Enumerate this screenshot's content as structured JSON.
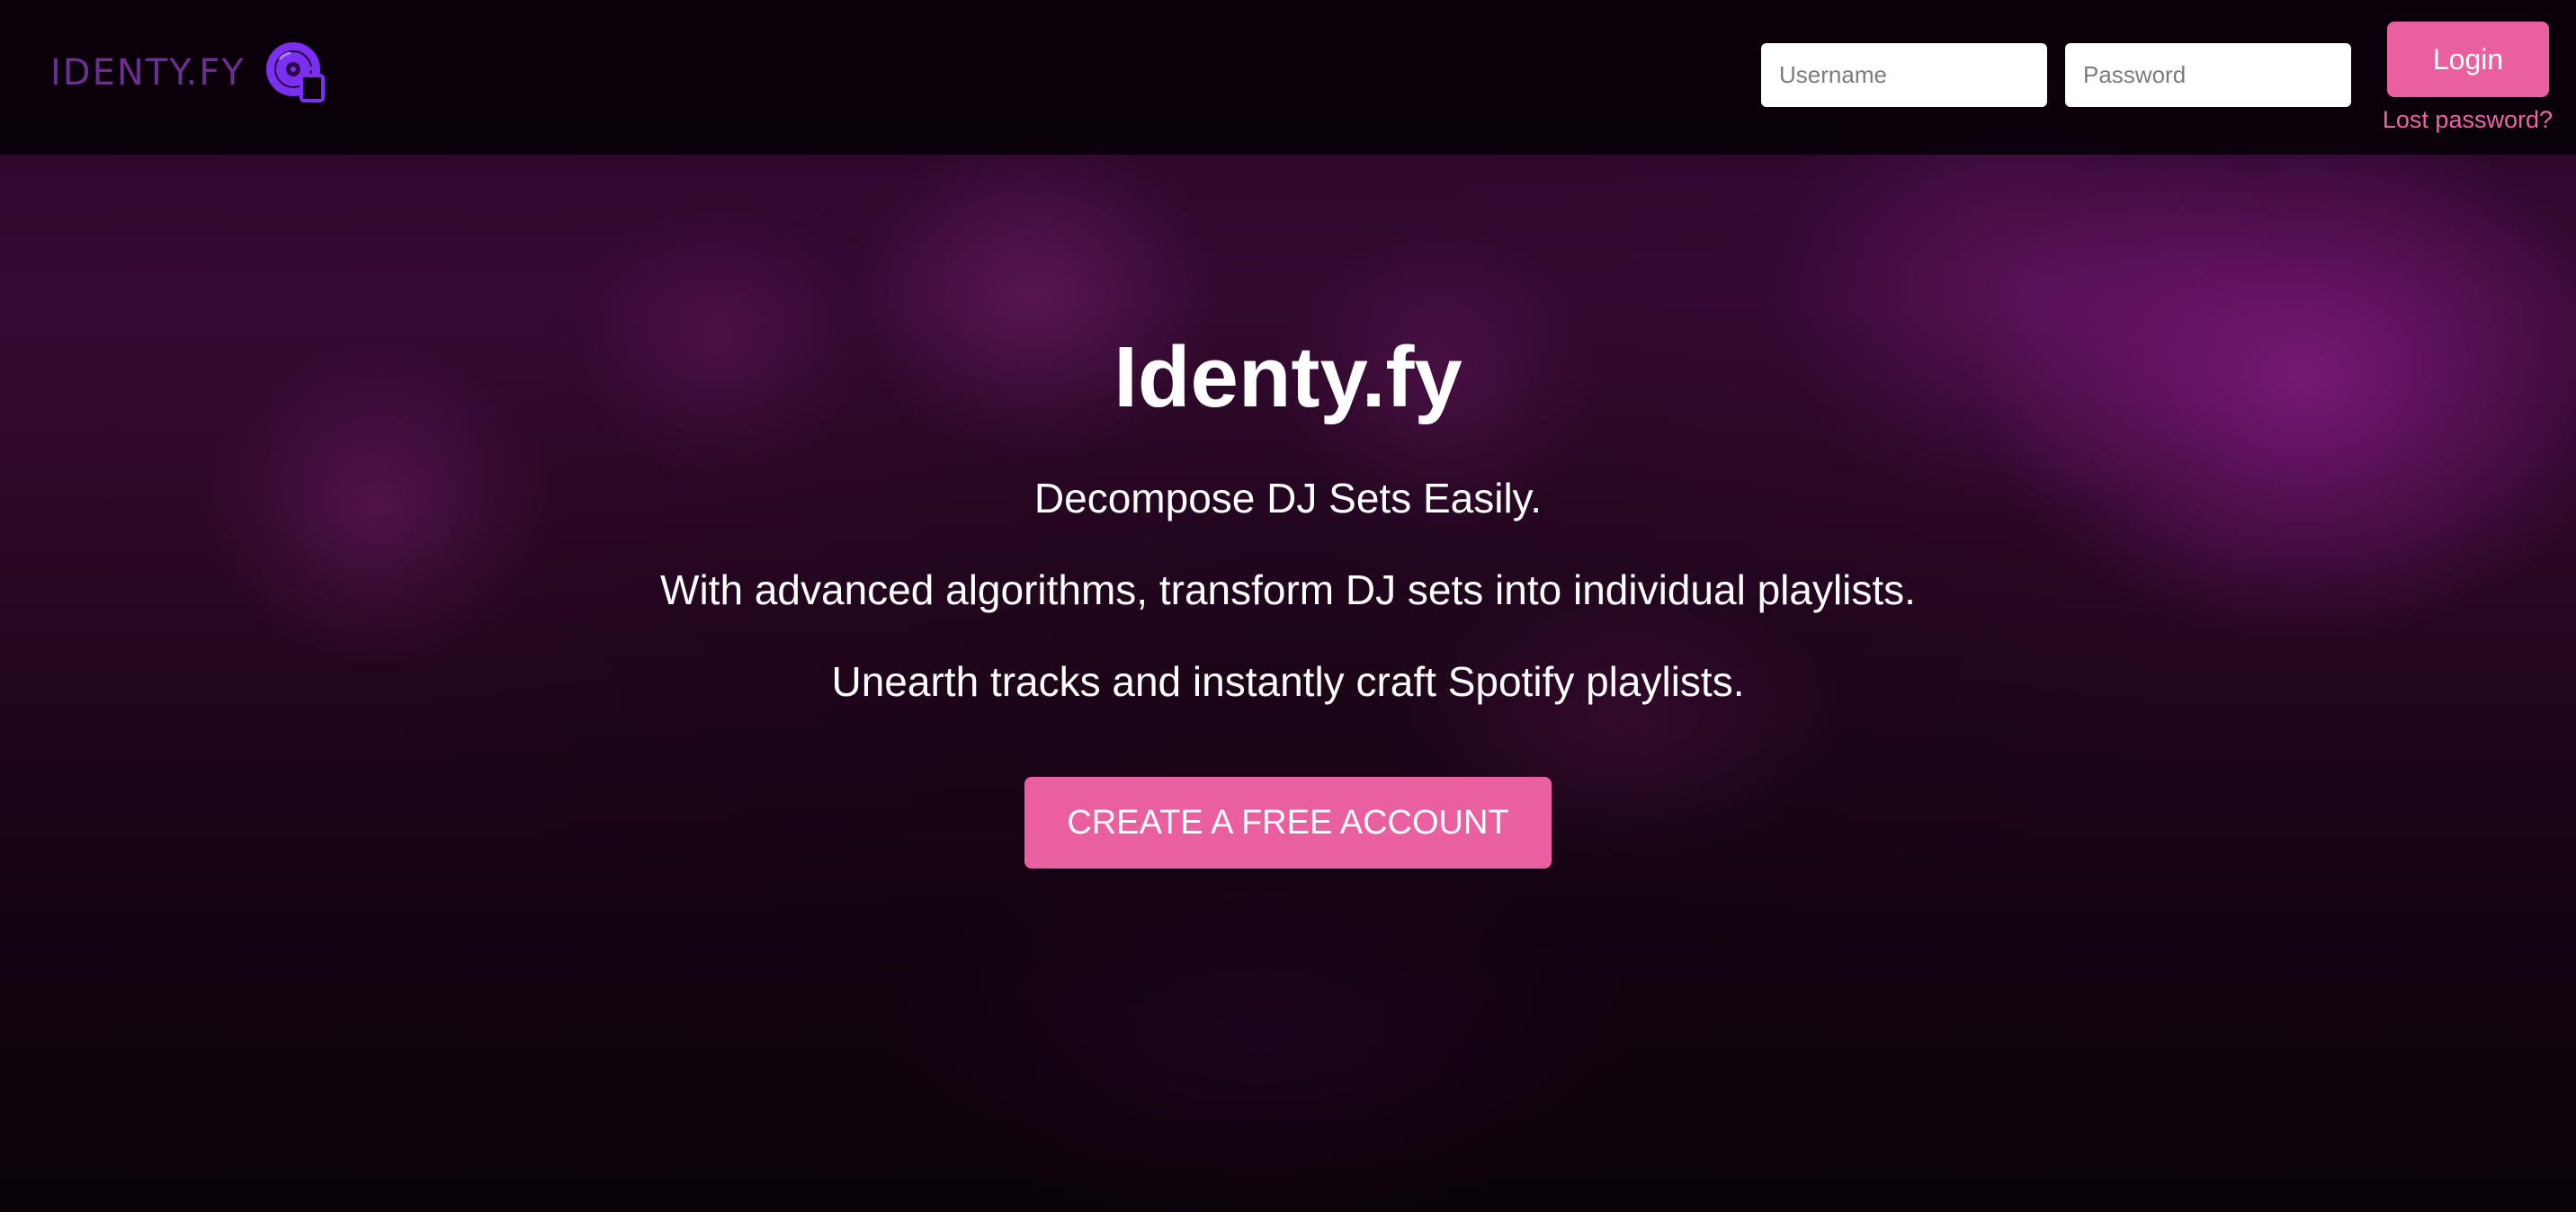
{
  "brand": {
    "logo_text": "IDENTY.FY",
    "logo_icon": "vinyl-disc-icon",
    "accent": "#ea5f9f",
    "logo_color": "#7b2ff0"
  },
  "header": {
    "username_placeholder": "Username",
    "password_placeholder": "Password",
    "login_label": "Login",
    "lost_password_label": "Lost password?"
  },
  "hero": {
    "title": "Identy.fy",
    "line1": "Decompose DJ Sets Easily.",
    "line2": "With advanced algorithms, transform DJ sets into individual playlists.",
    "line3": "Unearth tracks and instantly craft Spotify playlists.",
    "cta_label": "CREATE A FREE ACCOUNT"
  }
}
